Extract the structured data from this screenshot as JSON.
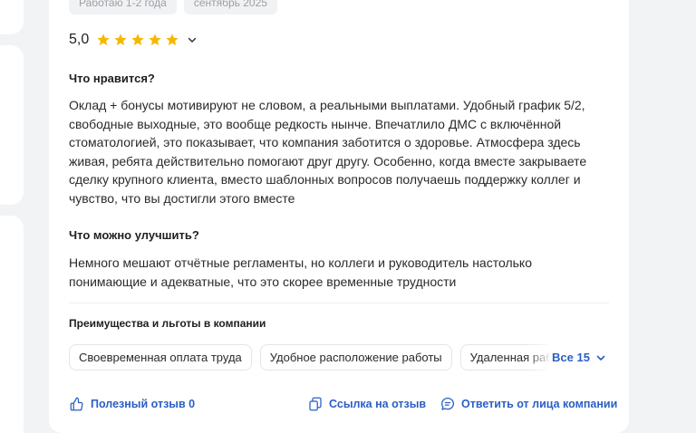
{
  "tags": [
    "Работаю 1-2 года",
    "сентябрь 2025"
  ],
  "rating": {
    "value": "5,0",
    "stars": 5,
    "star_color": "#f5b800"
  },
  "likes": {
    "title": "Что нравится?",
    "text": "Оклад + бонусы мотивируют не словом, а реальными выплатами. Удобный график 5/2, свободные выходные, это вообще редкость нынче. Впечатлило ДМС с включённой стоматологией, это показывает, что компания заботится о здоровье. Атмосфера здесь живая, ребята действительно помогают друг другу. Особенно, когда вместе закрываете сделку крупного клиента, вместо шаблонных вопросов получаешь поддержку коллег и чувство, что вы достигли этого вместе"
  },
  "improve": {
    "title": "Что можно улучшить?",
    "text": "Немного мешают отчётные регламенты, но коллеги и руководитель настолько понимающие и адекватные, что это скорее временные трудности"
  },
  "benefits": {
    "title": "Преимущества и льготы в компании",
    "chips": [
      "Своевременная оплата труда",
      "Удобное расположение работы",
      "Удаленная работа"
    ],
    "show_all": "Все 15"
  },
  "actions": {
    "helpful": "Полезный отзыв 0",
    "link": "Ссылка на отзыв",
    "reply": "Ответить от лица компании"
  },
  "colors": {
    "link": "#2b5fc4",
    "background": "#f2f3f5"
  }
}
